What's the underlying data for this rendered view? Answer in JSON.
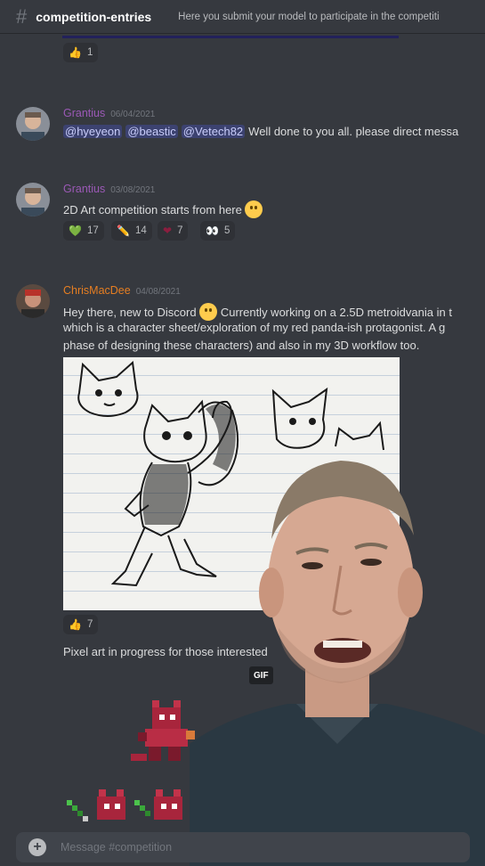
{
  "header": {
    "channel": "competition-entries",
    "topic": "Here you submit your model to participate in the competiti"
  },
  "top_reaction": {
    "emoji": "👍",
    "count": "1"
  },
  "messages": [
    {
      "author": "Grantius",
      "author_color": "#9b59b6",
      "time": "06/04/2021",
      "mentions": [
        "@hyeyeon",
        "@beastic",
        "@Vetech82"
      ],
      "text": "Well done to you all. please direct messa"
    },
    {
      "author": "Grantius",
      "author_color": "#9b59b6",
      "time": "03/08/2021",
      "text": "2D Art competition starts from here",
      "reactions": [
        {
          "emoji": "💚",
          "count": "17"
        },
        {
          "emoji": "✏️",
          "count": "14"
        },
        {
          "emoji": "❤",
          "count": "7"
        },
        {
          "emoji": "👀",
          "count": "5"
        }
      ]
    },
    {
      "author": "ChrisMacDee",
      "author_color": "#e67e22",
      "time": "04/08/2021",
      "lines": [
        "Hey there, new to Discord",
        "Currently working on a 2.5D metroidvania in t",
        "which is a character sheet/exploration of my red panda-ish protagonist. A g",
        "phase of designing these characters) and also in my 3D workflow too."
      ],
      "image_reaction": {
        "emoji": "👍",
        "count": "7"
      },
      "text2": "Pixel art in progress for those interested",
      "gif_label": "GIF"
    }
  ],
  "composer": {
    "placeholder": "Message #competition",
    "plus": "+"
  }
}
